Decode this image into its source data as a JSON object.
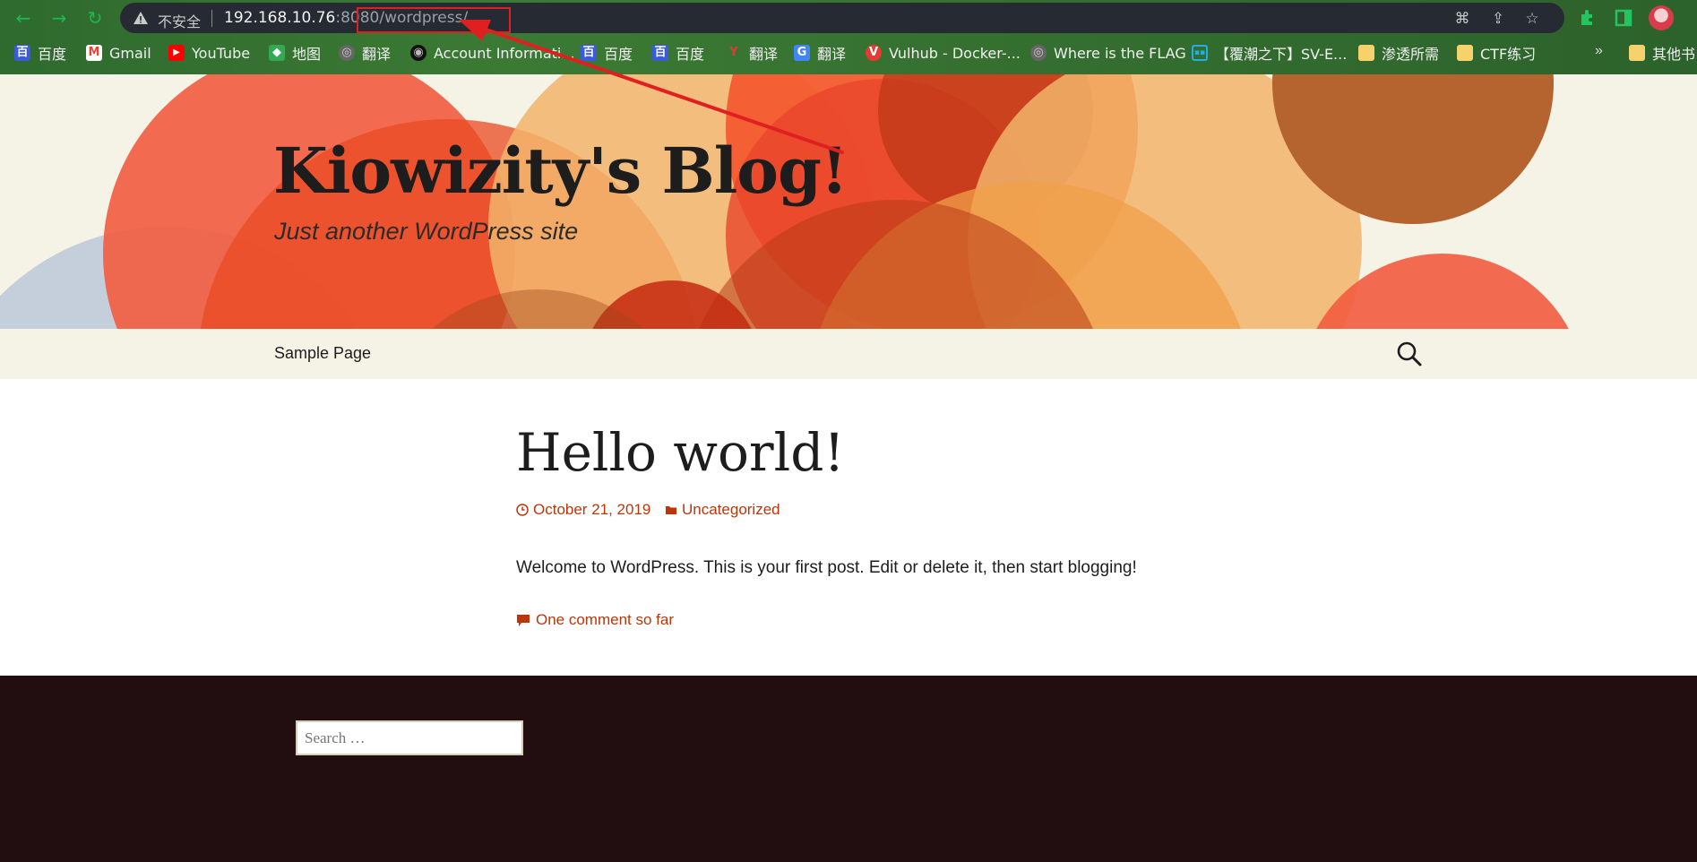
{
  "browser": {
    "security_label": "不安全",
    "url_host": "192.168.10.76",
    "url_rest": ":8080/wordpress/",
    "bookmarks": [
      {
        "label": "百度",
        "icon": "baidu-icon"
      },
      {
        "label": "Gmail",
        "icon": "gmail-icon"
      },
      {
        "label": "YouTube",
        "icon": "youtube-icon"
      },
      {
        "label": "地图",
        "icon": "maps-icon"
      },
      {
        "label": "翻译",
        "icon": "globe-icon"
      },
      {
        "label": "Account Informati...",
        "icon": "account-icon"
      },
      {
        "label": "百度",
        "icon": "baidu-icon"
      },
      {
        "label": "百度",
        "icon": "baidu-icon"
      },
      {
        "label": "翻译",
        "icon": "youdao-icon"
      },
      {
        "label": "翻译",
        "icon": "google-translate-icon"
      },
      {
        "label": "Vulhub - Docker-...",
        "icon": "vulhub-icon"
      },
      {
        "label": "Where is the FLAG",
        "icon": "globe-icon"
      },
      {
        "label": "【覆潮之下】SV-E...",
        "icon": "bilibili-icon"
      },
      {
        "label": "渗透所需",
        "icon": "folder-icon"
      },
      {
        "label": "CTF练习",
        "icon": "folder-icon"
      }
    ],
    "more_bookmarks": "»",
    "other_bookmarks": "其他书"
  },
  "site": {
    "title": "Kiowizity's Blog!",
    "description": "Just another WordPress site",
    "nav": [
      "Sample Page"
    ]
  },
  "post": {
    "title": "Hello world!",
    "date": "October 21, 2019",
    "category": "Uncategorized",
    "excerpt": "Welcome to WordPress. This is your first post. Edit or delete it, then start blogging!",
    "comments_link": "One comment so far"
  },
  "footer": {
    "search_placeholder": "Search …"
  },
  "colors": {
    "link": "#bc360a",
    "header_bg": "#f5f2e6",
    "footer_bg": "#220e10",
    "annotation": "#e02020"
  }
}
